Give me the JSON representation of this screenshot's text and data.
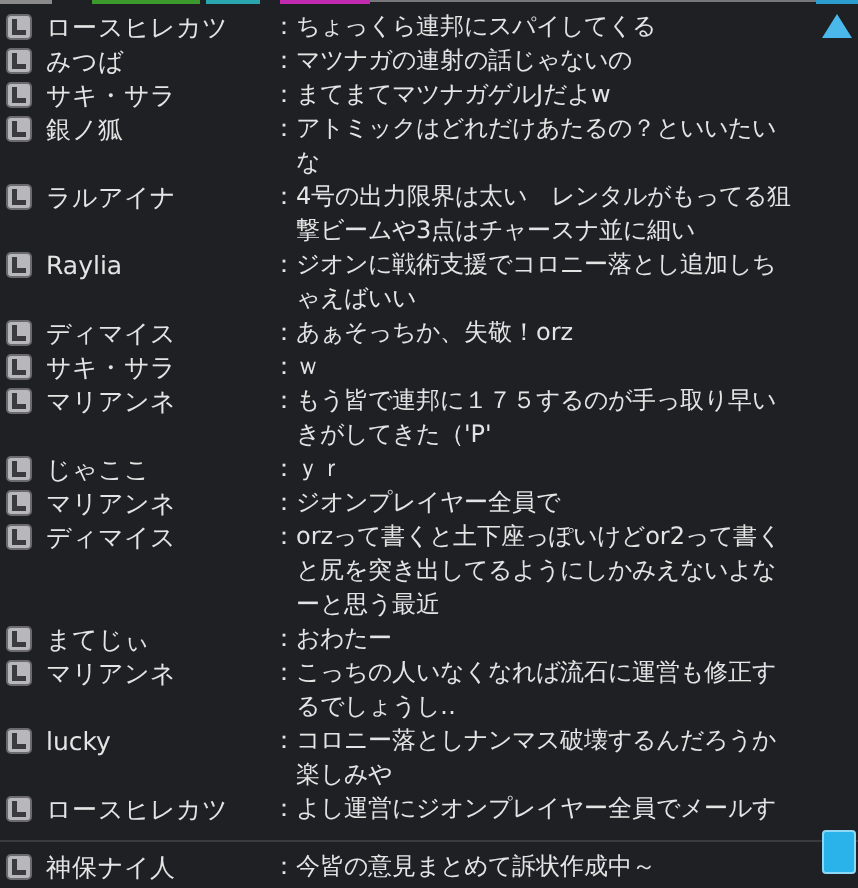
{
  "chat_log": [
    {
      "name": "ロースヒレカツ",
      "separator": "：",
      "lines": [
        "ちょっくら連邦にスパイしてくる"
      ]
    },
    {
      "name": "みつば",
      "separator": "：",
      "lines": [
        "マツナガの連射の話じゃないの"
      ]
    },
    {
      "name": "サキ・サラ",
      "separator": "：",
      "lines": [
        "まてまてマツナガゲルJだよw"
      ]
    },
    {
      "name": "銀ノ狐",
      "separator": "：",
      "lines": [
        "アトミックはどれだけあたるの？といいたい",
        "な"
      ]
    },
    {
      "name": "ラルアイナ",
      "separator": "：",
      "lines": [
        "4号の出力限界は太い　レンタルがもってる狙",
        "撃ビームや3点はチャースナ並に細い"
      ]
    },
    {
      "name": "Raylia",
      "separator": "：",
      "lines": [
        "ジオンに戦術支援でコロニー落とし追加しち",
        "ゃえばいい"
      ]
    },
    {
      "name": "ディマイス",
      "separator": "：",
      "lines": [
        "あぁそっちか、失敬！orz"
      ]
    },
    {
      "name": "サキ・サラ",
      "separator": "：",
      "lines": [
        "ｗ"
      ]
    },
    {
      "name": "マリアンネ",
      "separator": "：",
      "lines": [
        "もう皆で連邦に１７５するのが手っ取り早い",
        "きがしてきた（'P'"
      ]
    },
    {
      "name": "じゃここ",
      "separator": "：",
      "lines": [
        "ｙｒ"
      ]
    },
    {
      "name": "マリアンネ",
      "separator": "：",
      "lines": [
        "ジオンプレイヤー全員で"
      ]
    },
    {
      "name": "ディマイス",
      "separator": "：",
      "lines": [
        "orzって書くと土下座っぽいけどor2って書く",
        "と尻を突き出してるようにしかみえないよな",
        "ーと思う最近"
      ]
    },
    {
      "name": "まてじぃ",
      "separator": "：",
      "lines": [
        "おわたー"
      ]
    },
    {
      "name": "マリアンネ",
      "separator": "：",
      "lines": [
        "こっちの人いなくなれば流石に運営も修正す",
        "るでしょうし‥"
      ]
    },
    {
      "name": "lucky",
      "separator": "：",
      "lines": [
        "コロニー落としナンマス破壊するんだろうか",
        "楽しみや"
      ]
    },
    {
      "name": "ロースヒレカツ",
      "separator": "：",
      "lines": [
        "よし運営にジオンプレイヤー全員でメールす"
      ]
    }
  ],
  "latest": {
    "name": "神保ナイ人",
    "separator": "：",
    "lines": [
      "今皆の意見まとめて訴状作成中～"
    ]
  }
}
